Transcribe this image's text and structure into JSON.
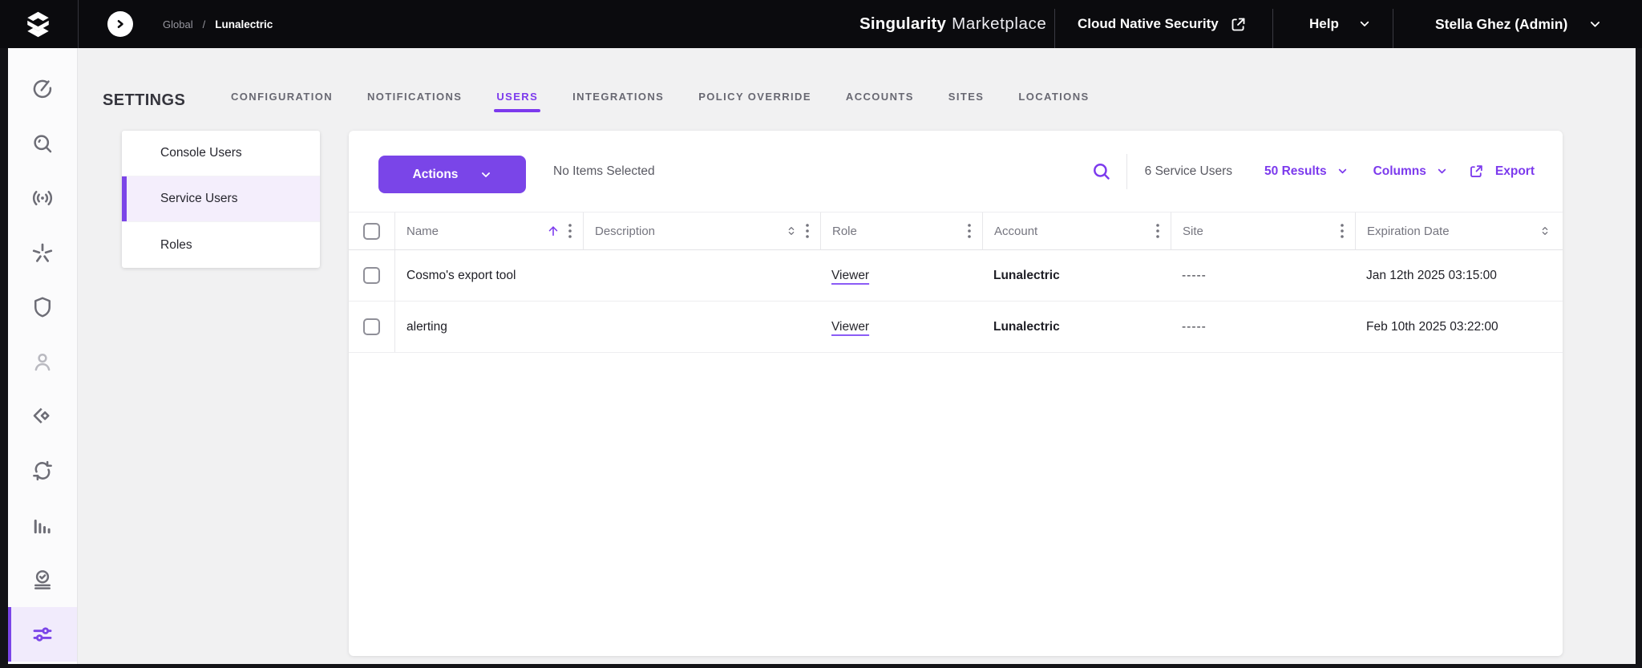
{
  "topbar": {
    "breadcrumb": {
      "root": "Global",
      "separator": "/",
      "current": "Lunalectric"
    },
    "brand_primary": "Singularity",
    "brand_secondary": "Marketplace",
    "product_link": "Cloud Native Security",
    "help_label": "Help",
    "user_label": "Stella Ghez (Admin)"
  },
  "sidebar": {
    "icons": [
      "gauge",
      "search",
      "broadcast",
      "asterisk",
      "shield",
      "user",
      "package",
      "sync",
      "bar-chart",
      "task-check",
      "sliders"
    ],
    "active_icon": "sliders"
  },
  "settings": {
    "title": "SETTINGS",
    "tabs": [
      "CONFIGURATION",
      "NOTIFICATIONS",
      "USERS",
      "INTEGRATIONS",
      "POLICY OVERRIDE",
      "ACCOUNTS",
      "SITES",
      "LOCATIONS"
    ],
    "active_tab": "USERS"
  },
  "subnav": {
    "items": [
      "Console Users",
      "Service Users",
      "Roles"
    ],
    "active_item": "Service Users"
  },
  "toolbar": {
    "actions_label": "Actions",
    "selection_status": "No Items Selected",
    "count_label": "6 Service Users",
    "results_label": "50 Results",
    "columns_label": "Columns",
    "export_label": "Export"
  },
  "table": {
    "columns": [
      "Name",
      "Description",
      "Role",
      "Account",
      "Site",
      "Expiration Date"
    ],
    "sort": {
      "column": "Name",
      "direction": "asc"
    },
    "rows": [
      {
        "name": "Cosmo's export tool",
        "description": "",
        "role": "Viewer",
        "account": "Lunalectric",
        "site": "-----",
        "expiration": "Jan 12th 2025 03:15:00"
      },
      {
        "name": "alerting",
        "description": "",
        "role": "Viewer",
        "account": "Lunalectric",
        "site": "-----",
        "expiration": "Feb 10th 2025 03:22:00"
      }
    ]
  },
  "colors": {
    "accent": "#7c3aed",
    "button": "#7a45e8",
    "topbar_bg": "#0b0b0e",
    "page_bg": "#f1f1f2",
    "active_nav_bg": "#f4eefc"
  }
}
